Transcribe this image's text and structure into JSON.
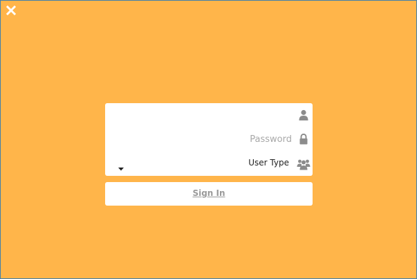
{
  "window": {
    "background_color": "#FFB54A",
    "border_color": "#3E7FAE"
  },
  "close_button": {
    "icon": "close-icon",
    "color": "#FFFFFF"
  },
  "form": {
    "username": {
      "value": "",
      "placeholder": "",
      "icon": "user-icon"
    },
    "password": {
      "value": "",
      "placeholder": "Password",
      "icon": "lock-icon"
    },
    "user_type": {
      "selected": "User Type",
      "dropdown_icon": "caret-down-icon",
      "icon": "users-group-icon"
    },
    "icon_color": "#8C8C8C"
  },
  "sign_in_button": {
    "label": "Sign In",
    "color": "#9A9A9A"
  }
}
